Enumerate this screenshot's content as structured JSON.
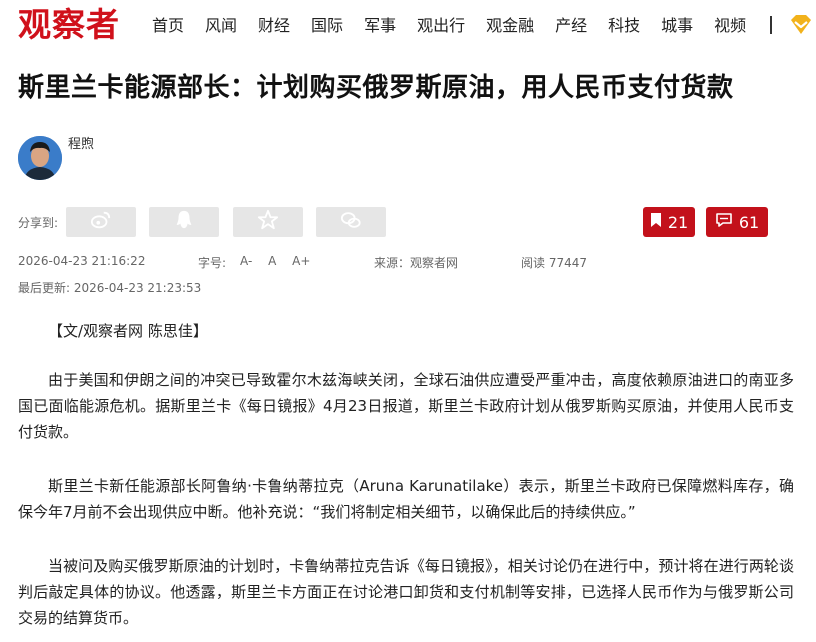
{
  "site": {
    "logo_text": "观察者",
    "brand_color": "#d0111b"
  },
  "nav": {
    "items": [
      "首页",
      "风闻",
      "财经",
      "国际",
      "军事",
      "观出行",
      "观金融",
      "产经",
      "科技",
      "城事",
      "视频"
    ],
    "vip_icon": "vip-diamond-icon"
  },
  "article": {
    "title": "斯里兰卡能源部长：计划购买俄罗斯原油，用人民币支付货款",
    "author": "程煦",
    "share_label": "分享到:",
    "share_buttons": [
      "weibo-icon",
      "qq-icon",
      "qzone-icon",
      "wechat-icon"
    ],
    "bookmark_count": "21",
    "comment_count": "61",
    "publish_time": "2026-04-23 21:16:22",
    "font_size_label": "字号:",
    "font_sizes": [
      "A-",
      "A",
      "A+"
    ],
    "source": "来源：观察者网",
    "reads": "阅读 77447",
    "updated": "最后更新: 2026-04-23 21:23:53",
    "byline": "【文/观察者网 陈思佳】",
    "paragraphs": [
      "由于美国和伊朗之间的冲突已导致霍尔木兹海峡关闭，全球石油供应遭受严重冲击，高度依赖原油进口的南亚多国已面临能源危机。据斯里兰卡《每日镜报》4月23日报道，斯里兰卡政府计划从俄罗斯购买原油，并使用人民币支付货款。",
      "斯里兰卡新任能源部长阿鲁纳·卡鲁纳蒂拉克（Aruna Karunatilake）表示，斯里兰卡政府已保障燃料库存，确保今年7月前不会出现供应中断。他补充说：“我们将制定相关细节，以确保此后的持续供应。”",
      "当被问及购买俄罗斯原油的计划时，卡鲁纳蒂拉克告诉《每日镜报》，相关讨论仍在进行中，预计将在进行两轮谈判后敲定具体的协议。他透露，斯里兰卡方面正在讨论港口卸货和支付机制等安排，已选择人民币作为与俄罗斯公司交易的结算货币。"
    ]
  }
}
